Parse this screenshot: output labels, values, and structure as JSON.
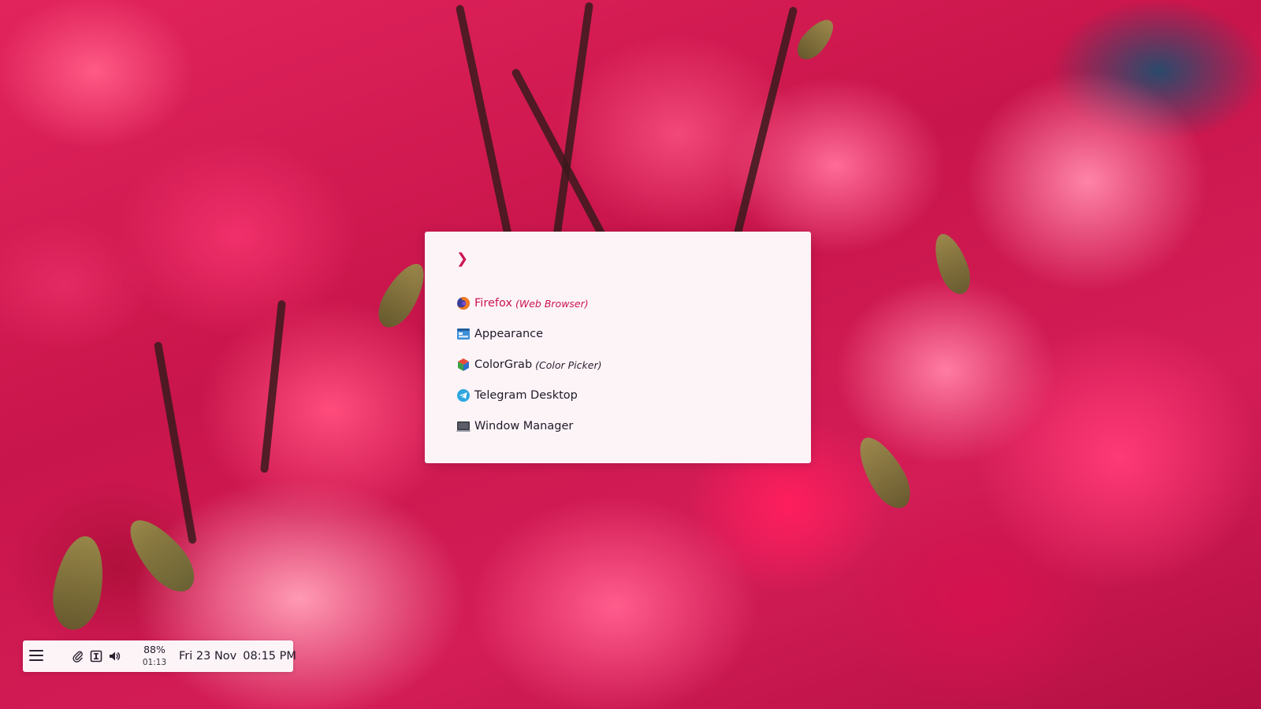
{
  "launcher": {
    "prompt_symbol": "❯",
    "query": "",
    "entries": [
      {
        "name": "Firefox",
        "generic": "(Web Browser)",
        "icon": "firefox-icon",
        "selected": true
      },
      {
        "name": "Appearance",
        "generic": "",
        "icon": "appearance-icon",
        "selected": false
      },
      {
        "name": "ColorGrab",
        "generic": "(Color Picker)",
        "icon": "colorgrab-icon",
        "selected": false
      },
      {
        "name": "Telegram Desktop",
        "generic": "",
        "icon": "telegram-icon",
        "selected": false
      },
      {
        "name": "Window Manager",
        "generic": "",
        "icon": "window-manager-icon",
        "selected": false
      }
    ],
    "accent_color": "#cc1450",
    "background_color": "#fdf4f8"
  },
  "bar": {
    "menu_icon": "hamburger-menu-icon",
    "tray_icons": [
      "paperclip-icon",
      "keyboard-layout-icon",
      "volume-icon"
    ],
    "battery_percent": "88%",
    "battery_time": "01:13",
    "date": "Fri 23 Nov",
    "time": "08:15 PM"
  }
}
